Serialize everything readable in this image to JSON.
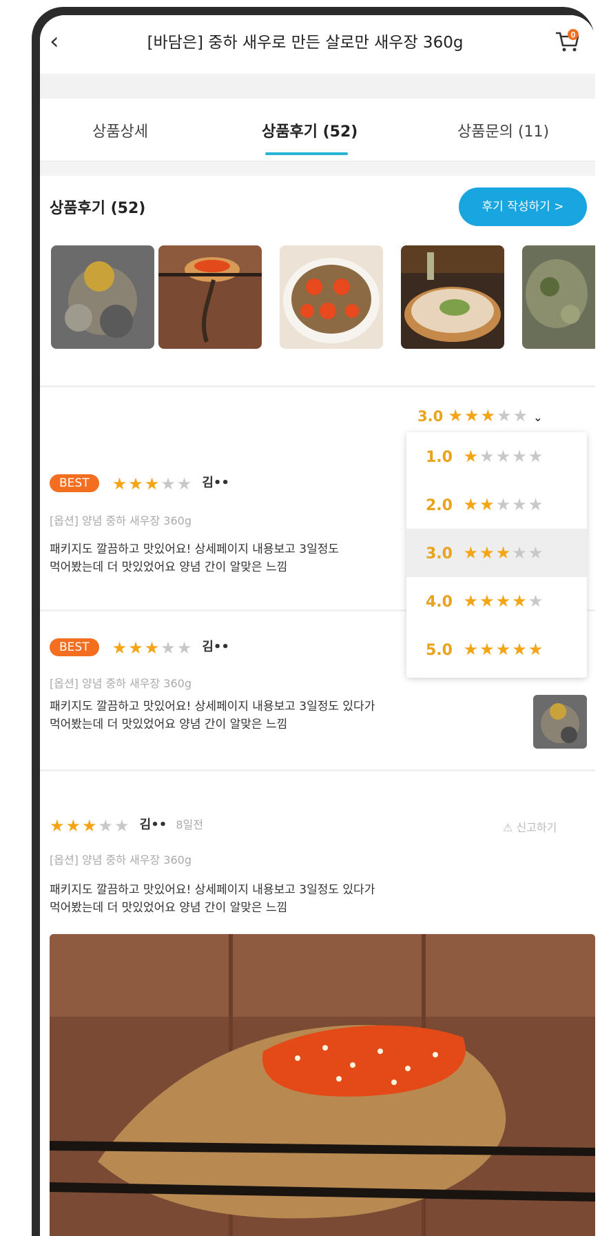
{
  "header": {
    "back_icon": "chevron-left-icon",
    "title": "[바담은] 중하 새우로 만든 살로만 새우장 360g",
    "cart_icon": "cart-icon",
    "cart_count": "0"
  },
  "tabs": [
    {
      "label": "상품상세"
    },
    {
      "label": "상품후기 (52)"
    },
    {
      "label": "상품문의 (11)"
    }
  ],
  "reviews_section": {
    "title": "상품후기 (52)",
    "write_button": "후기 작성하기 >"
  },
  "filter": {
    "selected": "3.0",
    "options": [
      {
        "label": "1.0",
        "stars": 1
      },
      {
        "label": "2.0",
        "stars": 2
      },
      {
        "label": "3.0",
        "stars": 3
      },
      {
        "label": "4.0",
        "stars": 4
      },
      {
        "label": "5.0",
        "stars": 5
      }
    ]
  },
  "reviews": [
    {
      "badge": "BEST",
      "stars": 3,
      "author": "김••",
      "option": "[옵션] 양념 중하 새우장 360g",
      "text_line1": "패키지도 깔끔하고 맛있어요! 상세페이지 내용보고 3일정도",
      "text_line2": "먹어봤는데 더 맛있었어요 양념 간이 알맞은 느낌"
    },
    {
      "badge": "BEST",
      "stars": 3,
      "author": "김••",
      "option": "[옵션] 양념 중하 새우장 360g",
      "text_line1": "패키지도 깔끔하고 맛있어요! 상세페이지 내용보고 3일정도 있다가",
      "text_line2": "먹어봤는데 더 맛있었어요 양념 간이 알맞은 느낌"
    },
    {
      "stars": 3,
      "author": "김••",
      "date": "8일전",
      "report_label": "신고하기",
      "option": "[옵션] 양념 중하 새우장 360g",
      "text_line1": "패키지도 깔끔하고 맛있어요! 상세페이지 내용보고 3일정도 있다가",
      "text_line2": "먹어봤는데 더 맛있었어요 양념 간이 알맞은 느낌"
    }
  ],
  "colors": {
    "accent": "#19a6e0",
    "star": "#f5a416",
    "badge": "#f36e1f"
  }
}
